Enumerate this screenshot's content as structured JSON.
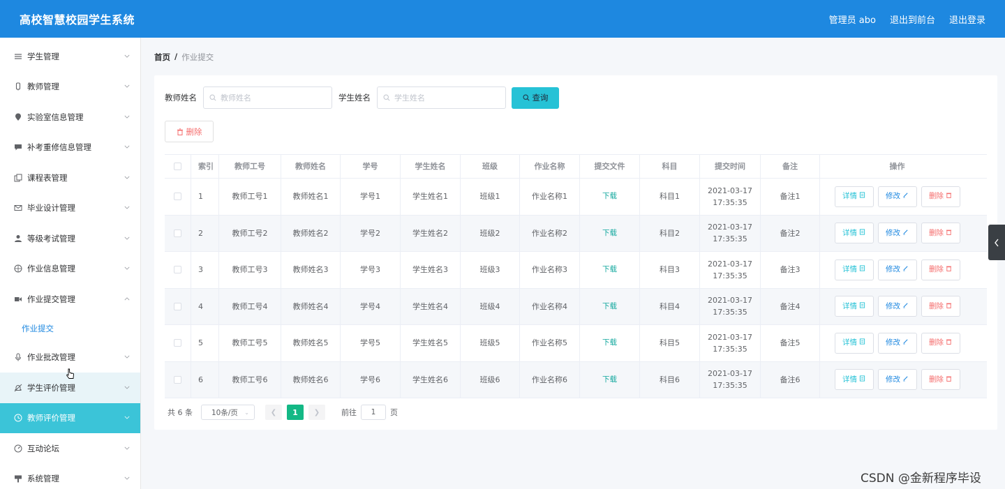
{
  "header": {
    "title": "高校智慧校园学生系统",
    "admin": "管理员 abo",
    "to_front": "退出到前台",
    "logout": "退出登录"
  },
  "sidebar": {
    "items": [
      {
        "label": "学生管理",
        "icon": "list-icon"
      },
      {
        "label": "教师管理",
        "icon": "badge-icon"
      },
      {
        "label": "实验室信息管理",
        "icon": "location-icon"
      },
      {
        "label": "补考重修信息管理",
        "icon": "chat-icon"
      },
      {
        "label": "课程表管理",
        "icon": "copy-icon"
      },
      {
        "label": "毕业设计管理",
        "icon": "mail-icon"
      },
      {
        "label": "等级考试管理",
        "icon": "user-icon"
      },
      {
        "label": "作业信息管理",
        "icon": "compass-icon"
      },
      {
        "label": "作业提交管理",
        "icon": "video-icon",
        "expanded": true
      },
      {
        "label": "作业批改管理",
        "icon": "mic-icon"
      },
      {
        "label": "学生评价管理",
        "icon": "bell-off-icon",
        "state": "hover"
      },
      {
        "label": "教师评价管理",
        "icon": "clock-icon",
        "state": "active"
      },
      {
        "label": "互动论坛",
        "icon": "speed-icon"
      },
      {
        "label": "系统管理",
        "icon": "sign-icon"
      }
    ],
    "submenu": {
      "label": "作业提交"
    }
  },
  "breadcrumb": {
    "home": "首页",
    "sep": "/",
    "current": "作业提交"
  },
  "search": {
    "teacher_label": "教师姓名",
    "teacher_placeholder": "教师姓名",
    "student_label": "学生姓名",
    "student_placeholder": "学生姓名",
    "query_button": "查询"
  },
  "actions": {
    "delete_button": "删除"
  },
  "table": {
    "headers": [
      "索引",
      "教师工号",
      "教师姓名",
      "学号",
      "学生姓名",
      "班级",
      "作业名称",
      "提交文件",
      "科目",
      "提交时间",
      "备注",
      "操作"
    ],
    "rows": [
      {
        "index": "1",
        "teacher_no": "教师工号1",
        "teacher_name": "教师姓名1",
        "student_no": "学号1",
        "student_name": "学生姓名1",
        "class": "班级1",
        "hw_name": "作业名称1",
        "file": "下载",
        "subject": "科目1",
        "date": "2021-03-17",
        "time": "17:35:35",
        "note": "备注1"
      },
      {
        "index": "2",
        "teacher_no": "教师工号2",
        "teacher_name": "教师姓名2",
        "student_no": "学号2",
        "student_name": "学生姓名2",
        "class": "班级2",
        "hw_name": "作业名称2",
        "file": "下载",
        "subject": "科目2",
        "date": "2021-03-17",
        "time": "17:35:35",
        "note": "备注2"
      },
      {
        "index": "3",
        "teacher_no": "教师工号3",
        "teacher_name": "教师姓名3",
        "student_no": "学号3",
        "student_name": "学生姓名3",
        "class": "班级3",
        "hw_name": "作业名称3",
        "file": "下载",
        "subject": "科目3",
        "date": "2021-03-17",
        "time": "17:35:35",
        "note": "备注3"
      },
      {
        "index": "4",
        "teacher_no": "教师工号4",
        "teacher_name": "教师姓名4",
        "student_no": "学号4",
        "student_name": "学生姓名4",
        "class": "班级4",
        "hw_name": "作业名称4",
        "file": "下载",
        "subject": "科目4",
        "date": "2021-03-17",
        "time": "17:35:35",
        "note": "备注4"
      },
      {
        "index": "5",
        "teacher_no": "教师工号5",
        "teacher_name": "教师姓名5",
        "student_no": "学号5",
        "student_name": "学生姓名5",
        "class": "班级5",
        "hw_name": "作业名称5",
        "file": "下载",
        "subject": "科目5",
        "date": "2021-03-17",
        "time": "17:35:35",
        "note": "备注5"
      },
      {
        "index": "6",
        "teacher_no": "教师工号6",
        "teacher_name": "教师姓名6",
        "student_no": "学号6",
        "student_name": "学生姓名6",
        "class": "班级6",
        "hw_name": "作业名称6",
        "file": "下载",
        "subject": "科目6",
        "date": "2021-03-17",
        "time": "17:35:35",
        "note": "备注6"
      }
    ],
    "op_labels": {
      "detail": "详情",
      "edit": "修改",
      "delete": "删除"
    }
  },
  "pagination": {
    "total": "共 6 条",
    "page_size": "10条/页",
    "current_page": "1",
    "goto_prefix": "前往",
    "goto_value": "1",
    "goto_suffix": "页"
  },
  "watermark": "CSDN @金新程序毕设",
  "colors": {
    "header_bg": "#1e88e0",
    "accent": "#26c2d6",
    "active_menu": "#3bc4d8",
    "danger": "#f56c6c",
    "pager_active": "#13b885"
  }
}
